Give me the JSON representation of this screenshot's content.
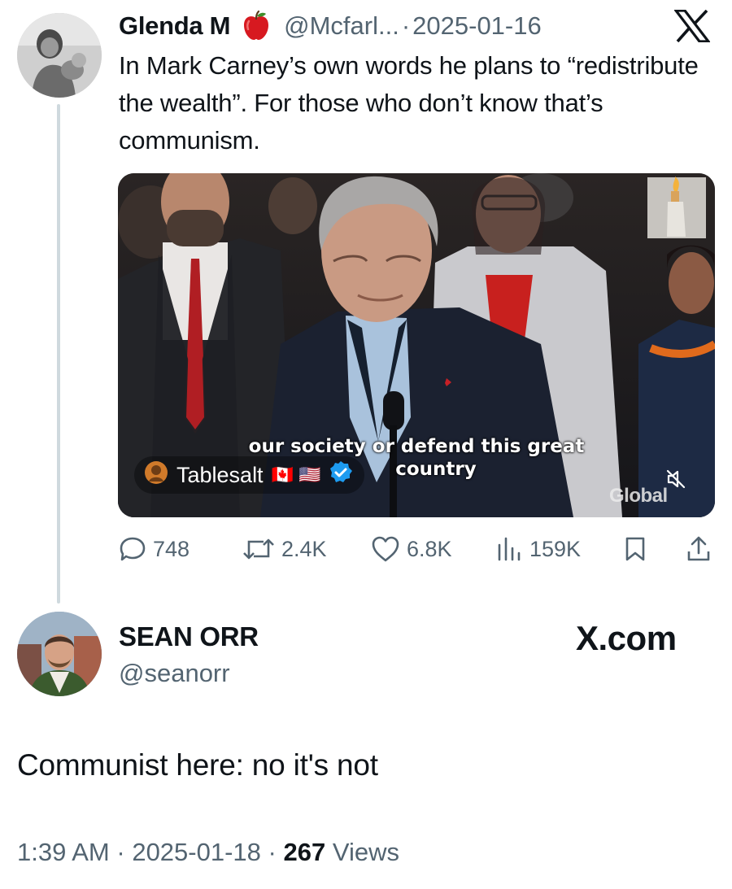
{
  "quoted_tweet": {
    "author_name": "Glenda M",
    "author_handle": "@Mcfarl...",
    "separator": "·",
    "date": "2025-01-16",
    "text": "In Mark Carney’s own words he plans to “redistribute the wealth”. For those who don’t know that’s communism.",
    "media": {
      "caption_line1": "our society or defend this great",
      "caption_line2": "country",
      "channel_name": "Tablesalt",
      "channel_flags": "🇨🇦 🇺🇸",
      "watermark": "Global"
    },
    "actions": {
      "replies": "748",
      "reposts": "2.4K",
      "likes": "6.8K",
      "views": "159K"
    }
  },
  "reply_tweet": {
    "author_name": "SEAN ORR",
    "author_handle": "@seanorr",
    "text": "Communist here: no it's not",
    "time": "1:39 AM",
    "separator": "·",
    "date": "2025-01-18",
    "views_count": "267",
    "views_label": "Views"
  },
  "brand": {
    "site": "X.com"
  },
  "icons": {
    "apple": "apple-emoji-icon",
    "x_logo": "x-logo-icon",
    "reply": "reply-icon",
    "repost": "repost-icon",
    "like": "heart-icon",
    "views": "analytics-icon",
    "bookmark": "bookmark-icon",
    "share": "share-icon",
    "verified": "verified-badge-icon",
    "mute": "muted-speaker-icon"
  },
  "colors": {
    "text_primary": "#0f1419",
    "text_secondary": "#536471",
    "thread_line": "#cfd9de",
    "verified_blue": "#1d9bf0",
    "tie_red": "#b01e23"
  }
}
